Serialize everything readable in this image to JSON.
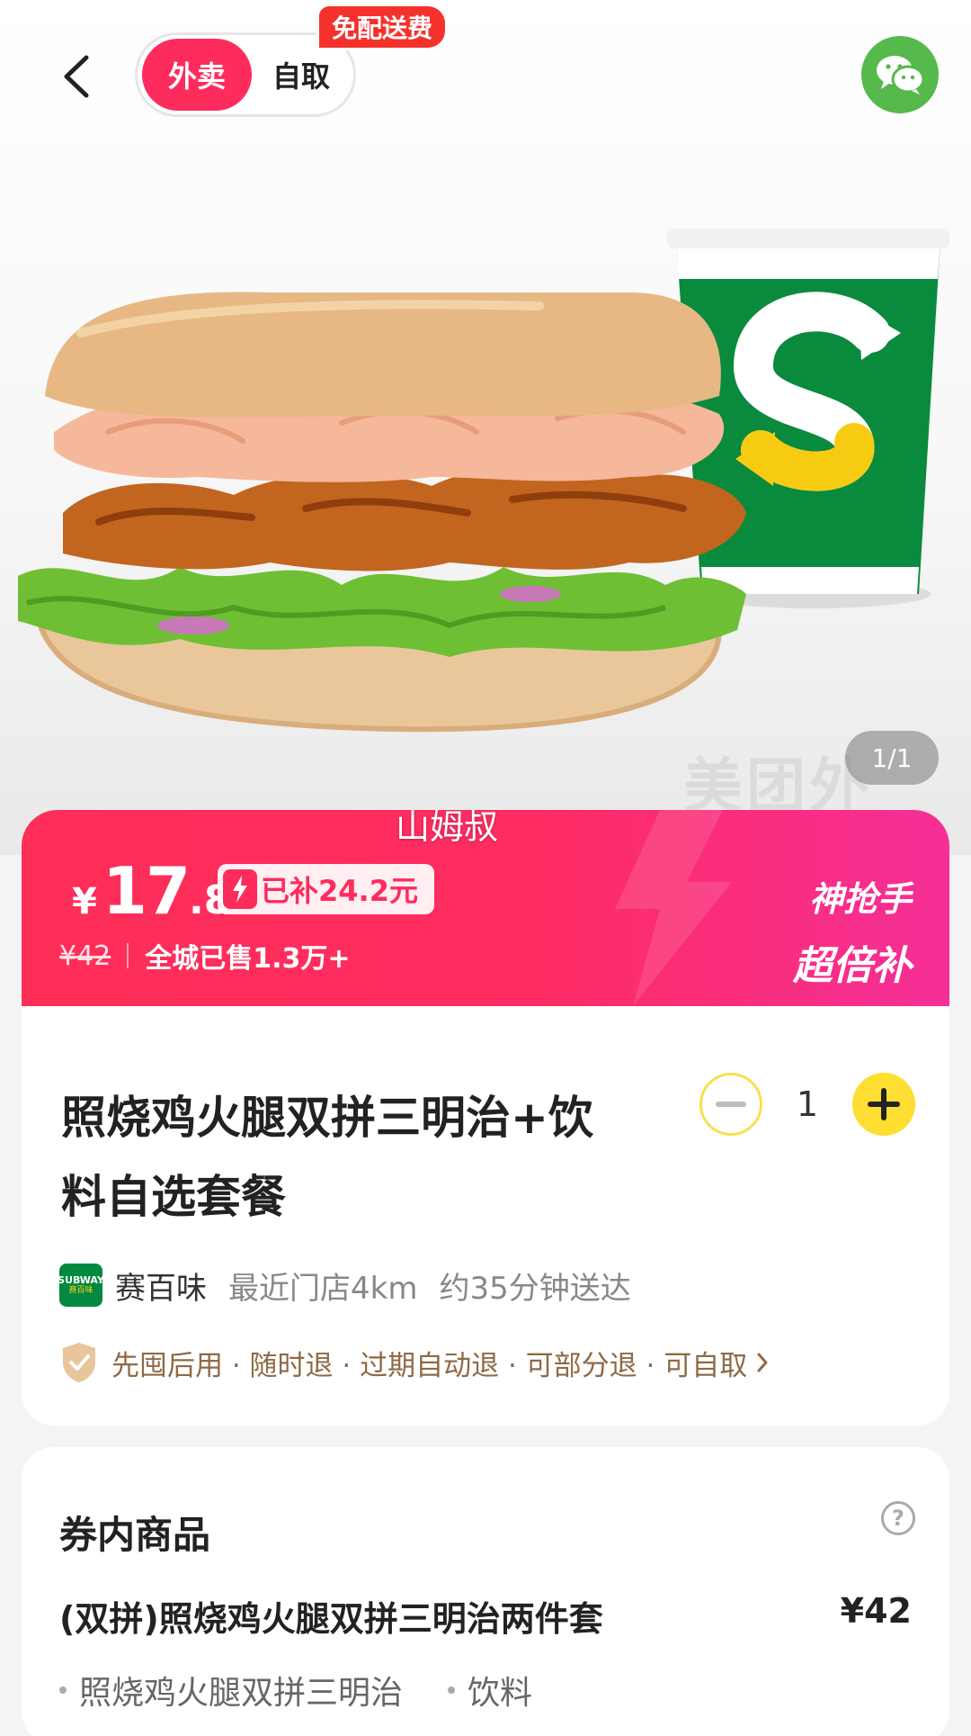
{
  "header": {
    "tabs": [
      {
        "label": "外卖",
        "active": true
      },
      {
        "label": "自取",
        "active": false
      }
    ],
    "free_delivery_tag": "免配送费",
    "back_icon": "chevron-left-icon",
    "share_icon": "wechat-icon"
  },
  "hero": {
    "page_indicator": "1/1",
    "watermark": "美团外"
  },
  "promo": {
    "shop_overlay": "山姆叔",
    "currency": "¥",
    "price_int": "17",
    "price_dec": ".8",
    "subsidy": "已补24.2元",
    "original_price": "¥42",
    "sold": "全城已售1.3万+",
    "badge_line1": "神抢手",
    "badge_line2": "超倍补",
    "colors": {
      "start": "#fe2e57",
      "end": "#f52f98"
    }
  },
  "product": {
    "title": "照烧鸡火腿双拼三明治+饮料自选套餐",
    "quantity": "1",
    "shop": {
      "logo_text": "SUBWAY",
      "logo_subtext": "赛百味",
      "name": "赛百味",
      "distance": "最近门店4km",
      "eta": "约35分钟送达"
    },
    "guarantee": "先囤后用 · 随时退 · 过期自动退 · 可部分退 · 可自取"
  },
  "coupon": {
    "title": "券内商品",
    "item_name": "(双拼)照烧鸡火腿双拼三明治两件套",
    "item_price": "¥42",
    "sub_items": [
      "照烧鸡火腿双拼三明治",
      "饮料"
    ]
  }
}
